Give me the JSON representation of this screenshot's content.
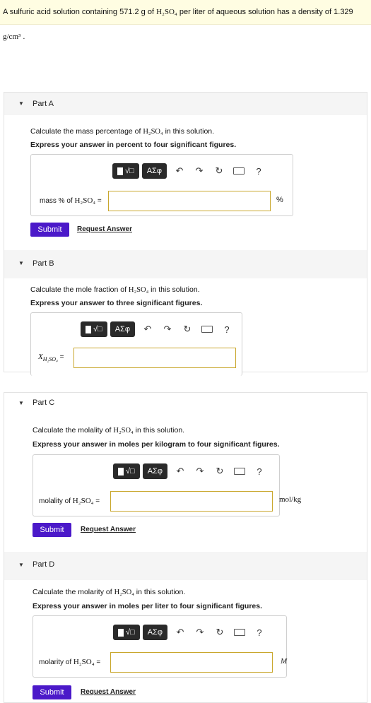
{
  "intro": {
    "text_a": "A sulfuric acid solution containing 571.2 g of ",
    "formula": "H₂SO₄",
    "text_b": " per liter of aqueous solution has a density of 1.329 ",
    "density_unit": "g/cm³",
    "text_c": " ."
  },
  "toolbar": {
    "templates_label": "√□",
    "greek_label": "AΣφ",
    "undo_glyph": "↶",
    "redo_glyph": "↷",
    "reset_glyph": "↻",
    "help_glyph": "?"
  },
  "formula": "H₂SO₄",
  "submit_label": "Submit",
  "request_label": "Request Answer",
  "parts": {
    "a": {
      "title": "Part A",
      "question_a": "Calculate the mass percentage of ",
      "question_b": " in this solution.",
      "instruction": "Express your answer in percent to four significant figures.",
      "label_a": "mass % of ",
      "label_b": " =",
      "value": "",
      "unit": "%"
    },
    "b": {
      "title": "Part B",
      "question_a": "Calculate the mole fraction of ",
      "question_b": " in this solution.",
      "instruction": "Express your answer to three significant figures.",
      "label_x": "X",
      "label_sub": "H₂SO₄",
      "label_eq": " =",
      "value": ""
    },
    "c": {
      "title": "Part C",
      "question_a": "Calculate the molality of ",
      "question_b": " in this solution.",
      "instruction": "Express your answer in moles per kilogram to four significant figures.",
      "label_a": "molality of ",
      "label_b": " =",
      "value": "",
      "unit": "mol/kg"
    },
    "d": {
      "title": "Part D",
      "question_a": "Calculate the molarity of ",
      "question_b": " in this solution.",
      "instruction": "Express your answer in moles per liter to four significant figures.",
      "label_a": "molarity of ",
      "label_b": " =",
      "value": "",
      "unit": "M"
    }
  },
  "colors": {
    "submit_bg": "#4b19c9",
    "field_border": "#c9a72d",
    "intro_bg": "#fffde2"
  }
}
